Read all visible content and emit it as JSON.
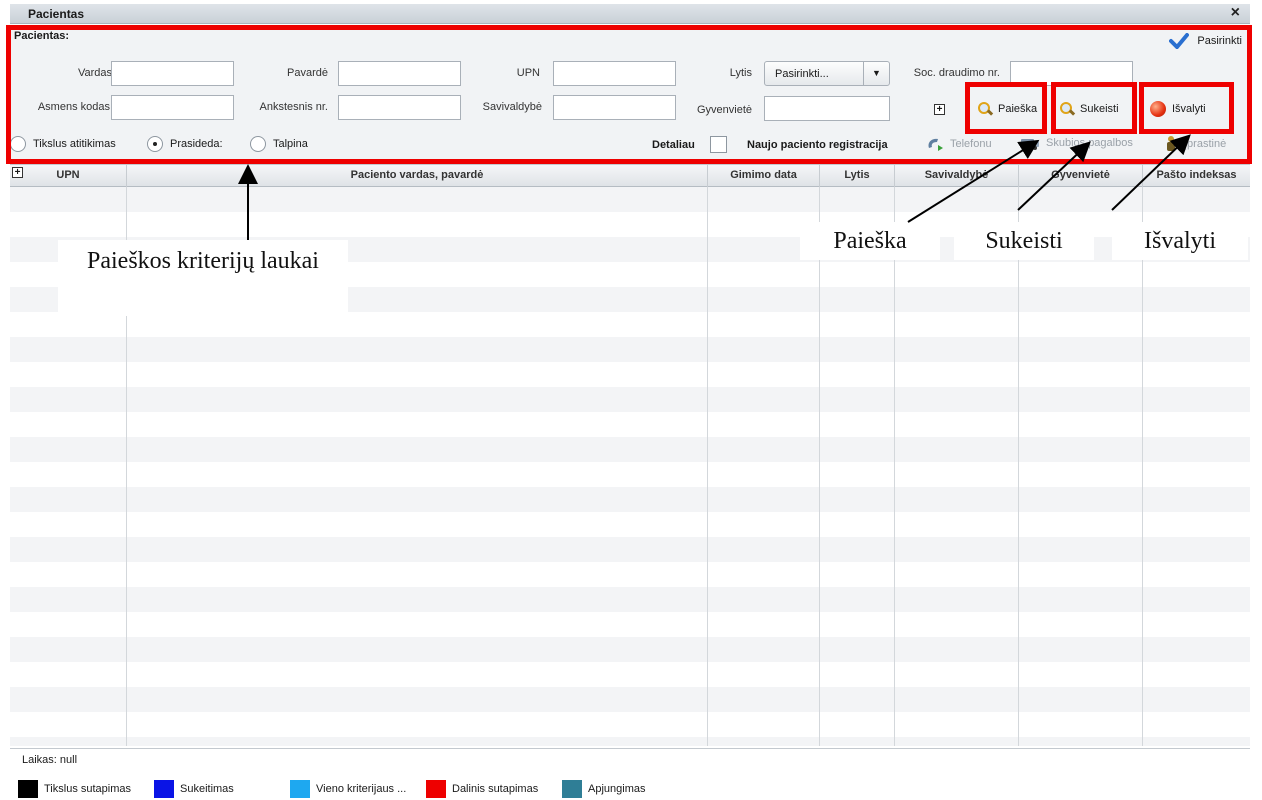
{
  "window": {
    "title": "Pacientas",
    "close_label": "×"
  },
  "criteria": {
    "header": "Pacientas:",
    "select_all": "Pasirinkti",
    "fields": {
      "vardas": {
        "label": "Vardas",
        "value": ""
      },
      "pavarde": {
        "label": "Pavardė",
        "value": ""
      },
      "upn": {
        "label": "UPN",
        "value": ""
      },
      "lytis": {
        "label": "Lytis",
        "value": "Pasirinkti..."
      },
      "soc": {
        "label": "Soc. draudimo nr.",
        "value": ""
      },
      "asmens_kodas": {
        "label": "Asmens kodas",
        "value": ""
      },
      "ankstesnis": {
        "label": "Ankstesnis nr.",
        "value": ""
      },
      "savivaldybe": {
        "label": "Savivaldybė",
        "value": ""
      },
      "gyvenviete": {
        "label": "Gyvenvietė",
        "value": ""
      }
    },
    "buttons": {
      "paieska": "Paieška",
      "sukeisti": "Sukeisti",
      "isvalyti": "Išvalyti"
    },
    "match_modes": {
      "options": [
        "Tikslus atitikimas",
        "Prasideda:",
        "Talpina"
      ],
      "selected": "Prasideda:"
    },
    "detaliau": "Detaliau",
    "registration_label": "Naujo paciento registracija",
    "registration_links": [
      "Telefonu",
      "Skubios pagalbos",
      "Įprastinė"
    ]
  },
  "grid": {
    "columns": [
      "UPN",
      "Paciento vardas, pavardė",
      "Gimimo data",
      "Lytis",
      "Savivaldybė",
      "Gyvenvietė",
      "Pašto indeksas"
    ],
    "rows": []
  },
  "status": {
    "text": "Laikas: null"
  },
  "legend": [
    {
      "label": "Tikslus sutapimas",
      "color": "#000000"
    },
    {
      "label": "Sukeitimas",
      "color": "#0a14e6"
    },
    {
      "label": "Vieno kriterijaus ...",
      "color": "#1ea8f0"
    },
    {
      "label": "Dalinis sutapimas",
      "color": "#ee0000"
    },
    {
      "label": "Apjungimas",
      "color": "#2f7e96"
    }
  ],
  "annotations": {
    "criteria_fields": "Paieškos kriterijų laukai",
    "paieska": "Paieška",
    "sukeisti": "Sukeisti",
    "isvalyti": "Išvalyti"
  }
}
